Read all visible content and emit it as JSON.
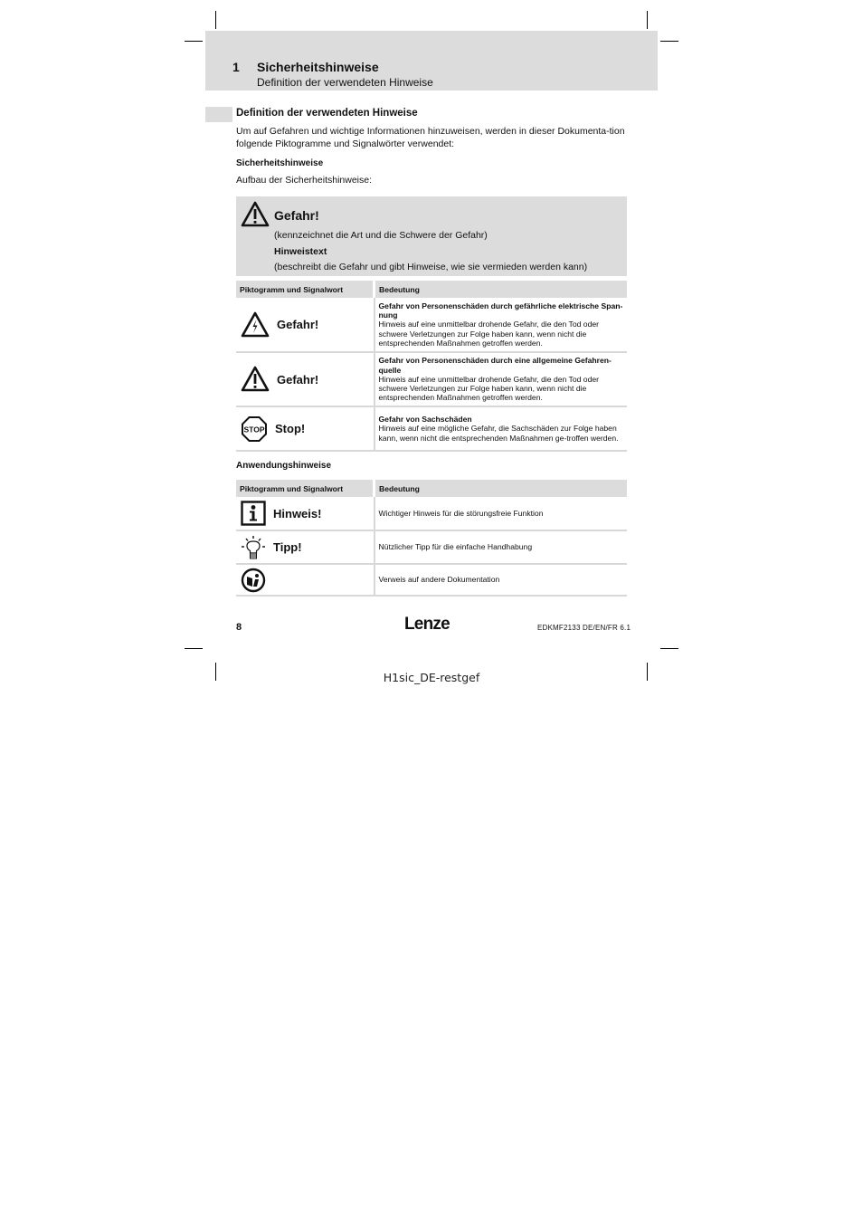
{
  "header": {
    "chapter_number": "1",
    "chapter_title": "Sicherheitshinweise",
    "chapter_subtitle": "Definition der verwendeten Hinweise"
  },
  "section": {
    "title": "Definition der verwendeten Hinweise",
    "intro": "Um auf Gefahren und wichtige Informationen hinzuweisen, werden in dieser Dokumenta-tion folgende Piktogramme und Signalwörter verwendet:",
    "safety_heading": "Sicherheitshinweise",
    "safety_intro": "Aufbau der Sicherheitshinweise:"
  },
  "sample_box": {
    "icon": "warning-triangle-icon",
    "signal_word": "Gefahr!",
    "line1": "(kennzeichnet die Art und die Schwere der Gefahr)",
    "line2": "Hinweistext",
    "line3": "(beschreibt die Gefahr und gibt Hinweise, wie sie vermieden werden kann)"
  },
  "safety_table": {
    "columns": [
      "Piktogramm und Signalwort",
      "Bedeutung"
    ],
    "rows": [
      {
        "icon": "electric-hazard-icon",
        "signal_word": "Gefahr!",
        "title": "Gefahr von Personenschäden durch gefährliche elektrische Span-nung",
        "text": "Hinweis auf eine unmittelbar drohende Gefahr, die den Tod oder schwere Verletzungen zur Folge haben kann, wenn nicht die entsprechenden Maßnahmen getroffen werden."
      },
      {
        "icon": "general-hazard-icon",
        "signal_word": "Gefahr!",
        "title": "Gefahr von Personenschäden durch eine allgemeine Gefahren-quelle",
        "text": "Hinweis auf eine unmittelbar drohende Gefahr, die den Tod oder schwere Verletzungen zur Folge haben kann, wenn nicht die entsprechenden Maßnahmen getroffen werden."
      },
      {
        "icon": "stop-sign-icon",
        "icon_text": "STOP",
        "signal_word": "Stop!",
        "title": "Gefahr von Sachschäden",
        "text": "Hinweis auf eine mögliche Gefahr, die Sachschäden zur Folge haben kann, wenn nicht die entsprechenden Maßnahmen ge-troffen werden."
      }
    ]
  },
  "application_heading": "Anwendungshinweise",
  "application_table": {
    "columns": [
      "Piktogramm und Signalwort",
      "Bedeutung"
    ],
    "rows": [
      {
        "icon": "info-icon",
        "signal_word": "Hinweis!",
        "text": "Wichtiger Hinweis für die störungsfreie Funktion"
      },
      {
        "icon": "lightbulb-icon",
        "signal_word": "Tipp!",
        "text": "Nützlicher Tipp für die einfache Handhabung"
      },
      {
        "icon": "document-reference-icon",
        "signal_word": "",
        "text": "Verweis auf andere Dokumentation"
      }
    ]
  },
  "footer": {
    "page_number": "8",
    "logo": "Lenze",
    "doc_id": "EDKMF2133  DE/EN/FR  6.1"
  },
  "file_label": "H1sic_DE-restgef"
}
